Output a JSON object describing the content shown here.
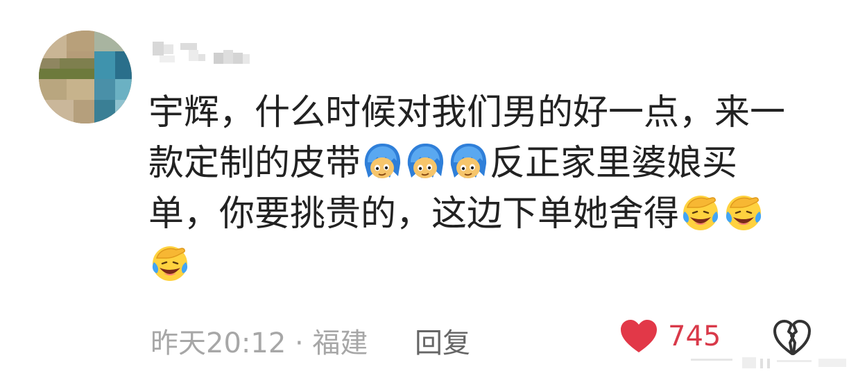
{
  "comment": {
    "segments": [
      {
        "type": "text",
        "value": "宇辉，什么时候对我们男的好一点，来一款定制的皮带"
      },
      {
        "type": "emoji",
        "name": "blue-hair-doge-emoji"
      },
      {
        "type": "emoji",
        "name": "blue-hair-doge-emoji"
      },
      {
        "type": "emoji",
        "name": "blue-hair-doge-emoji"
      },
      {
        "type": "text",
        "value": "反正家里婆娘买单，你要挑贵的，这边下单她舍得"
      },
      {
        "type": "emoji",
        "name": "facepalm-laugh-cry-emoji"
      },
      {
        "type": "emoji",
        "name": "facepalm-laugh-cry-emoji"
      },
      {
        "type": "emoji",
        "name": "facepalm-laugh-cry-emoji"
      }
    ],
    "text_part1": "宇辉，什么时候对我们男的好一点，来一款定制的皮带",
    "text_part2": "反正家里婆娘买单，你要挑贵的，这边下单她舍得"
  },
  "meta": {
    "time": "昨天20:12",
    "separator": "·",
    "location": "福建",
    "line": "昨天20:12 · 福建"
  },
  "actions": {
    "reply_label": "回复",
    "like_count": "745",
    "like_icon": "heart-icon",
    "dislike_icon": "broken-heart-icon"
  },
  "colors": {
    "text": "#222222",
    "meta": "#a7a7a7",
    "reply": "#666666",
    "like": "#e23848",
    "like_count": "#d93a4a",
    "dislike": "#333333"
  }
}
